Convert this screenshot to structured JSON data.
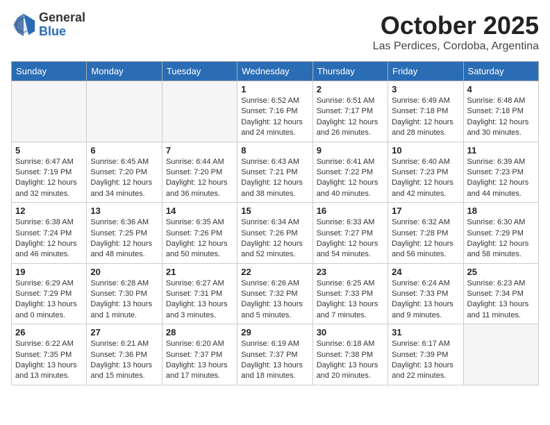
{
  "logo": {
    "general": "General",
    "blue": "Blue"
  },
  "title": "October 2025",
  "location": "Las Perdices, Cordoba, Argentina",
  "days_of_week": [
    "Sunday",
    "Monday",
    "Tuesday",
    "Wednesday",
    "Thursday",
    "Friday",
    "Saturday"
  ],
  "weeks": [
    [
      {
        "day": "",
        "info": ""
      },
      {
        "day": "",
        "info": ""
      },
      {
        "day": "",
        "info": ""
      },
      {
        "day": "1",
        "info": "Sunrise: 6:52 AM\nSunset: 7:16 PM\nDaylight: 12 hours\nand 24 minutes."
      },
      {
        "day": "2",
        "info": "Sunrise: 6:51 AM\nSunset: 7:17 PM\nDaylight: 12 hours\nand 26 minutes."
      },
      {
        "day": "3",
        "info": "Sunrise: 6:49 AM\nSunset: 7:18 PM\nDaylight: 12 hours\nand 28 minutes."
      },
      {
        "day": "4",
        "info": "Sunrise: 6:48 AM\nSunset: 7:18 PM\nDaylight: 12 hours\nand 30 minutes."
      }
    ],
    [
      {
        "day": "5",
        "info": "Sunrise: 6:47 AM\nSunset: 7:19 PM\nDaylight: 12 hours\nand 32 minutes."
      },
      {
        "day": "6",
        "info": "Sunrise: 6:45 AM\nSunset: 7:20 PM\nDaylight: 12 hours\nand 34 minutes."
      },
      {
        "day": "7",
        "info": "Sunrise: 6:44 AM\nSunset: 7:20 PM\nDaylight: 12 hours\nand 36 minutes."
      },
      {
        "day": "8",
        "info": "Sunrise: 6:43 AM\nSunset: 7:21 PM\nDaylight: 12 hours\nand 38 minutes."
      },
      {
        "day": "9",
        "info": "Sunrise: 6:41 AM\nSunset: 7:22 PM\nDaylight: 12 hours\nand 40 minutes."
      },
      {
        "day": "10",
        "info": "Sunrise: 6:40 AM\nSunset: 7:23 PM\nDaylight: 12 hours\nand 42 minutes."
      },
      {
        "day": "11",
        "info": "Sunrise: 6:39 AM\nSunset: 7:23 PM\nDaylight: 12 hours\nand 44 minutes."
      }
    ],
    [
      {
        "day": "12",
        "info": "Sunrise: 6:38 AM\nSunset: 7:24 PM\nDaylight: 12 hours\nand 46 minutes."
      },
      {
        "day": "13",
        "info": "Sunrise: 6:36 AM\nSunset: 7:25 PM\nDaylight: 12 hours\nand 48 minutes."
      },
      {
        "day": "14",
        "info": "Sunrise: 6:35 AM\nSunset: 7:26 PM\nDaylight: 12 hours\nand 50 minutes."
      },
      {
        "day": "15",
        "info": "Sunrise: 6:34 AM\nSunset: 7:26 PM\nDaylight: 12 hours\nand 52 minutes."
      },
      {
        "day": "16",
        "info": "Sunrise: 6:33 AM\nSunset: 7:27 PM\nDaylight: 12 hours\nand 54 minutes."
      },
      {
        "day": "17",
        "info": "Sunrise: 6:32 AM\nSunset: 7:28 PM\nDaylight: 12 hours\nand 56 minutes."
      },
      {
        "day": "18",
        "info": "Sunrise: 6:30 AM\nSunset: 7:29 PM\nDaylight: 12 hours\nand 58 minutes."
      }
    ],
    [
      {
        "day": "19",
        "info": "Sunrise: 6:29 AM\nSunset: 7:29 PM\nDaylight: 13 hours\nand 0 minutes."
      },
      {
        "day": "20",
        "info": "Sunrise: 6:28 AM\nSunset: 7:30 PM\nDaylight: 13 hours\nand 1 minute."
      },
      {
        "day": "21",
        "info": "Sunrise: 6:27 AM\nSunset: 7:31 PM\nDaylight: 13 hours\nand 3 minutes."
      },
      {
        "day": "22",
        "info": "Sunrise: 6:26 AM\nSunset: 7:32 PM\nDaylight: 13 hours\nand 5 minutes."
      },
      {
        "day": "23",
        "info": "Sunrise: 6:25 AM\nSunset: 7:33 PM\nDaylight: 13 hours\nand 7 minutes."
      },
      {
        "day": "24",
        "info": "Sunrise: 6:24 AM\nSunset: 7:33 PM\nDaylight: 13 hours\nand 9 minutes."
      },
      {
        "day": "25",
        "info": "Sunrise: 6:23 AM\nSunset: 7:34 PM\nDaylight: 13 hours\nand 11 minutes."
      }
    ],
    [
      {
        "day": "26",
        "info": "Sunrise: 6:22 AM\nSunset: 7:35 PM\nDaylight: 13 hours\nand 13 minutes."
      },
      {
        "day": "27",
        "info": "Sunrise: 6:21 AM\nSunset: 7:36 PM\nDaylight: 13 hours\nand 15 minutes."
      },
      {
        "day": "28",
        "info": "Sunrise: 6:20 AM\nSunset: 7:37 PM\nDaylight: 13 hours\nand 17 minutes."
      },
      {
        "day": "29",
        "info": "Sunrise: 6:19 AM\nSunset: 7:37 PM\nDaylight: 13 hours\nand 18 minutes."
      },
      {
        "day": "30",
        "info": "Sunrise: 6:18 AM\nSunset: 7:38 PM\nDaylight: 13 hours\nand 20 minutes."
      },
      {
        "day": "31",
        "info": "Sunrise: 6:17 AM\nSunset: 7:39 PM\nDaylight: 13 hours\nand 22 minutes."
      },
      {
        "day": "",
        "info": ""
      }
    ]
  ]
}
